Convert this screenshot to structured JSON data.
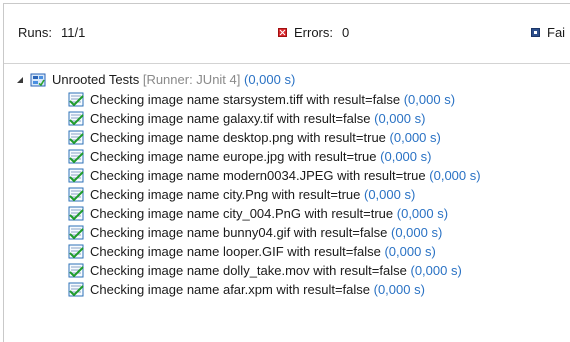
{
  "stats": {
    "runs_label": "Runs:",
    "runs_value": "11/1",
    "errors_label": "Errors:",
    "errors_value": "0",
    "failures_label": "Fai"
  },
  "tree": {
    "root": {
      "label": "Unrooted Tests",
      "runner": "[Runner: JUnit 4]",
      "time": "(0,000 s)"
    },
    "items": [
      {
        "text": "Checking image name starsystem.tiff with result=false",
        "time": "(0,000 s)"
      },
      {
        "text": "Checking image name galaxy.tif with result=false",
        "time": "(0,000 s)"
      },
      {
        "text": "Checking image name desktop.png with result=true",
        "time": "(0,000 s)"
      },
      {
        "text": "Checking image name europe.jpg with result=true",
        "time": "(0,000 s)"
      },
      {
        "text": "Checking image name modern0034.JPEG with result=true",
        "time": "(0,000 s)"
      },
      {
        "text": "Checking image name city.Png with result=true",
        "time": "(0,000 s)"
      },
      {
        "text": "Checking image name city_004.PnG with result=true",
        "time": "(0,000 s)"
      },
      {
        "text": "Checking image name bunny04.gif with result=false",
        "time": "(0,000 s)"
      },
      {
        "text": "Checking image name looper.GIF with result=false",
        "time": "(0,000 s)"
      },
      {
        "text": "Checking image name dolly_take.mov with result=false",
        "time": "(0,000 s)"
      },
      {
        "text": "Checking image name afar.xpm with result=false",
        "time": "(0,000 s)"
      }
    ]
  },
  "icons": {
    "root": "test-suite-icon",
    "item": "test-passed-icon",
    "errors": "error-icon",
    "failures": "failure-icon",
    "expander": "tree-expanded-icon"
  }
}
